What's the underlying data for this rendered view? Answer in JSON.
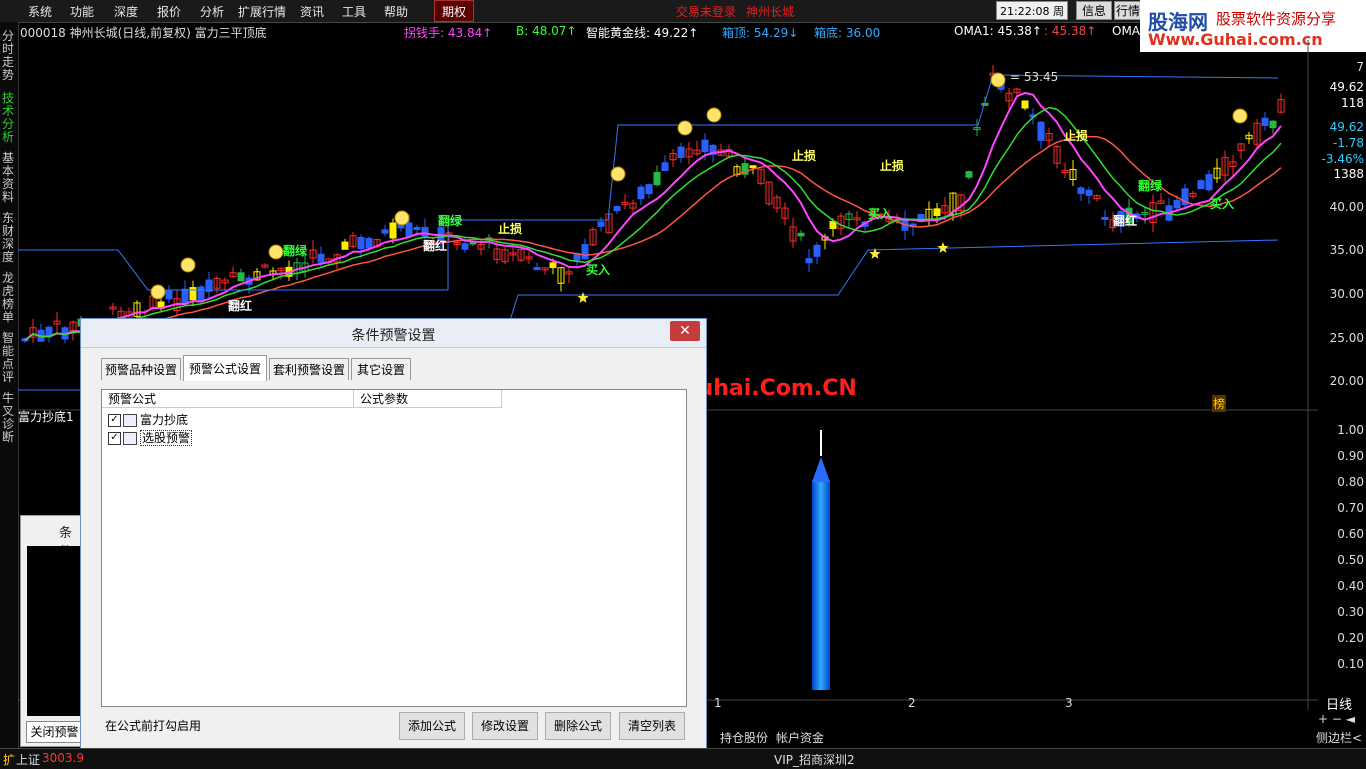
{
  "menu": {
    "items": [
      "系统",
      "功能",
      "深度",
      "报价",
      "分析",
      "扩展行情",
      "资讯",
      "工具",
      "帮助"
    ],
    "period_tab": "期权",
    "trade_status": "交易未登录",
    "stock_name_red": "神州长城",
    "time": "21:22:08",
    "weekday": "周四",
    "info_btn": "信息",
    "quote_btn": "行情"
  },
  "watermark": {
    "logo": "股海网",
    "slogan": "股票软件资源分享",
    "url": "Www.Guhai.com.cn",
    "center_text": "股海网提供 Www.Guhai.Com.CN"
  },
  "left_nav": [
    "分时走势",
    "技术分析",
    "基本资料",
    "东财深度",
    "龙虎榜单",
    "智能点评",
    "牛叉诊断"
  ],
  "stock_info": {
    "code_title": "000018 神州长城(日线,前复权) 富力三平顶底",
    "indicators": [
      {
        "label": "拐钱手: 43.84↑",
        "color": "#ff44ff"
      },
      {
        "label": "B: 48.07↑",
        "color": "#33ff33"
      },
      {
        "label": "智能黄金线: 49.22↑",
        "color": "#ffffff"
      },
      {
        "label": "箱顶: 54.29↓",
        "color": "#33aaff"
      },
      {
        "label": "箱底: 36.00",
        "color": "#33aaff"
      },
      {
        "label": "OMA1: 45.38↑",
        "color": "#ffffff"
      },
      {
        "label": ": 45.38↑",
        "color": "#ff4444"
      },
      {
        "label": "OMA:",
        "color": "#ffffff"
      }
    ]
  },
  "chart": {
    "top_price_label": "= 53.45",
    "price_axis": [
      "7",
      "49.62",
      "118",
      "49.62",
      "-1.78",
      "-3.46%",
      "1388",
      "40.00",
      "35.00",
      "30.00",
      "25.00",
      "20.00"
    ],
    "indicator_axis": [
      "1.00",
      "0.90",
      "0.80",
      "0.70",
      "0.60",
      "0.50",
      "0.40",
      "0.30",
      "0.20",
      "0.10"
    ],
    "x_ticks": [
      "1",
      "2",
      "3"
    ],
    "period": "日线",
    "annotations": {
      "fanlv": "翻绿",
      "fanhong": "翻红",
      "zhisun": "止损",
      "mairu": "买入"
    },
    "bang_label": "榜",
    "indicator_name": "富力抄底1"
  },
  "dialog": {
    "title": "条件预警设置",
    "close": "✕",
    "tabs": [
      "预警品种设置",
      "预警公式设置",
      "套利预警设置",
      "其它设置"
    ],
    "active_tab": 1,
    "columns": [
      "预警公式",
      "公式参数"
    ],
    "rows": [
      {
        "checked": true,
        "name": "富力抄底"
      },
      {
        "checked": true,
        "name": "选股预警"
      }
    ],
    "hint": "在公式前打勾启用",
    "buttons": [
      "添加公式",
      "修改设置",
      "删除公式",
      "清空列表"
    ]
  },
  "behind_window": {
    "title": "条件",
    "close_alert_btn": "关闭预警"
  },
  "status_bar": {
    "index_name": "上证",
    "index_value": "3003.9",
    "tabs": [
      "持仓股份",
      "帐户资金"
    ],
    "vip": "VIP_招商深圳2",
    "sidebar": "侧边栏<",
    "expand": "扩"
  }
}
